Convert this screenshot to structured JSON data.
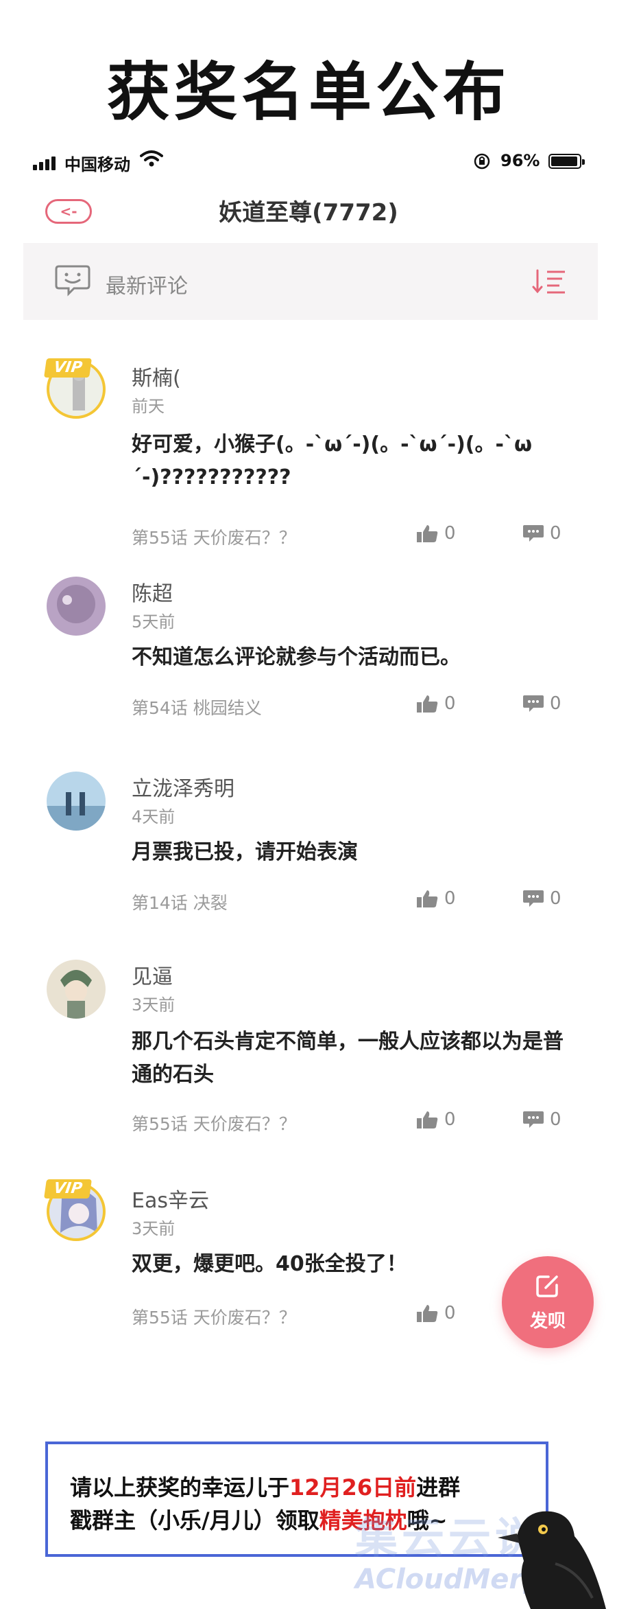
{
  "banner": {
    "title": "获奖名单公布"
  },
  "status_bar": {
    "carrier": "中国移动",
    "battery": "96%"
  },
  "nav": {
    "back_label": "<-",
    "title": "妖道至尊(7772)"
  },
  "section": {
    "label": "最新评论"
  },
  "comments": [
    {
      "username": "斯楠(",
      "time": "前天",
      "text": "好可爱，小猴子(。-`ω´-)(。-`ω´-)(。-`ω´-)???????????",
      "chapter": "第55话 天价废石？？",
      "likes": "0",
      "replies": "0",
      "vip": true,
      "vip_label": "VIP"
    },
    {
      "username": "陈超",
      "time": "5天前",
      "text": "不知道怎么评论就参与个活动而已。",
      "chapter": "第54话 桃园结义",
      "likes": "0",
      "replies": "0",
      "vip": false
    },
    {
      "username": "立泷泽秀明",
      "time": "4天前",
      "text": "月票我已投，请开始表演",
      "chapter": "第14话 决裂",
      "likes": "0",
      "replies": "0",
      "vip": false
    },
    {
      "username": "见逼",
      "time": "3天前",
      "text": "那几个石头肯定不简单，一般人应该都以为是普通的石头",
      "chapter": "第55话 天价废石？？",
      "likes": "0",
      "replies": "0",
      "vip": false
    },
    {
      "username": "Eas辛云",
      "time": "3天前",
      "text": "双更，爆更吧。40张全投了！",
      "chapter": "第55话 天价废石？？",
      "likes": "0",
      "vip": true,
      "vip_label": "VIP"
    }
  ],
  "fab": {
    "label": "发呗"
  },
  "notice": {
    "line1_a": "请以上获奖的幸运儿于",
    "line1_red": "12月26日前",
    "line1_b": "进群",
    "line2_a": "戳群主（小乐/月儿）领取",
    "line2_red": "精美抱枕",
    "line2_b": "哦~"
  },
  "watermark": {
    "cn": "集云云说",
    "en": "ACloudMerge"
  },
  "colors": {
    "accent": "#f06f7d",
    "nav_icon": "#e5677a",
    "notice_border": "#4a66d6",
    "highlight": "#e02020",
    "vip": "#f4c635"
  }
}
